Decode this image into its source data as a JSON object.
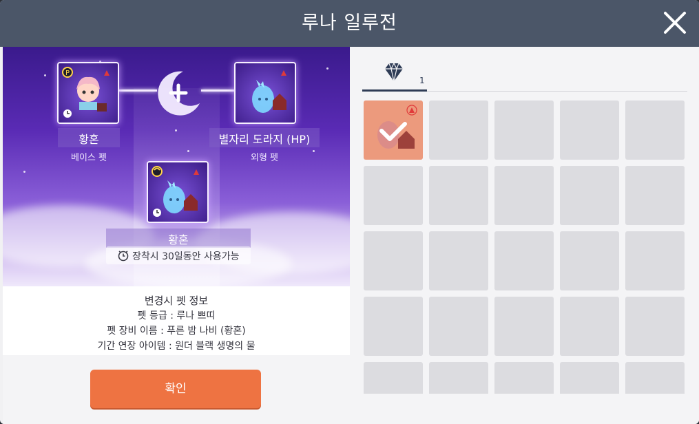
{
  "window": {
    "title": "루나 일루전"
  },
  "colors": {
    "header": "#4b5668",
    "accent": "#ee7342",
    "selected_cell": "#ec9a7d",
    "empty_cell": "#dcdce0"
  },
  "fusion": {
    "base": {
      "name": "황혼",
      "role": "베이스 펫",
      "icon": "pet-character-icon"
    },
    "appearance": {
      "name": "별자리 도라지 (HP)",
      "role": "외형 펫",
      "icon": "blue-spirit-pet-icon"
    },
    "result": {
      "name": "황혼",
      "icon": "blue-spirit-pet-icon"
    },
    "usable_text": "장착시 30일동안 사용가능"
  },
  "info": {
    "heading": "변경시 펫 정보",
    "lines": [
      "펫 등급 : 루나 쁘띠",
      "펫 장비 이름 : 푸른 밤 나비 (황혼)",
      "기간 연장 아이템 : 원더 블랙 생명의 물"
    ]
  },
  "confirm_label": "확인",
  "inventory": {
    "tab": {
      "icon": "diamond-icon",
      "count": "1"
    },
    "selected_item": {
      "icon": "blue-spirit-pet-icon",
      "checked": true
    }
  }
}
